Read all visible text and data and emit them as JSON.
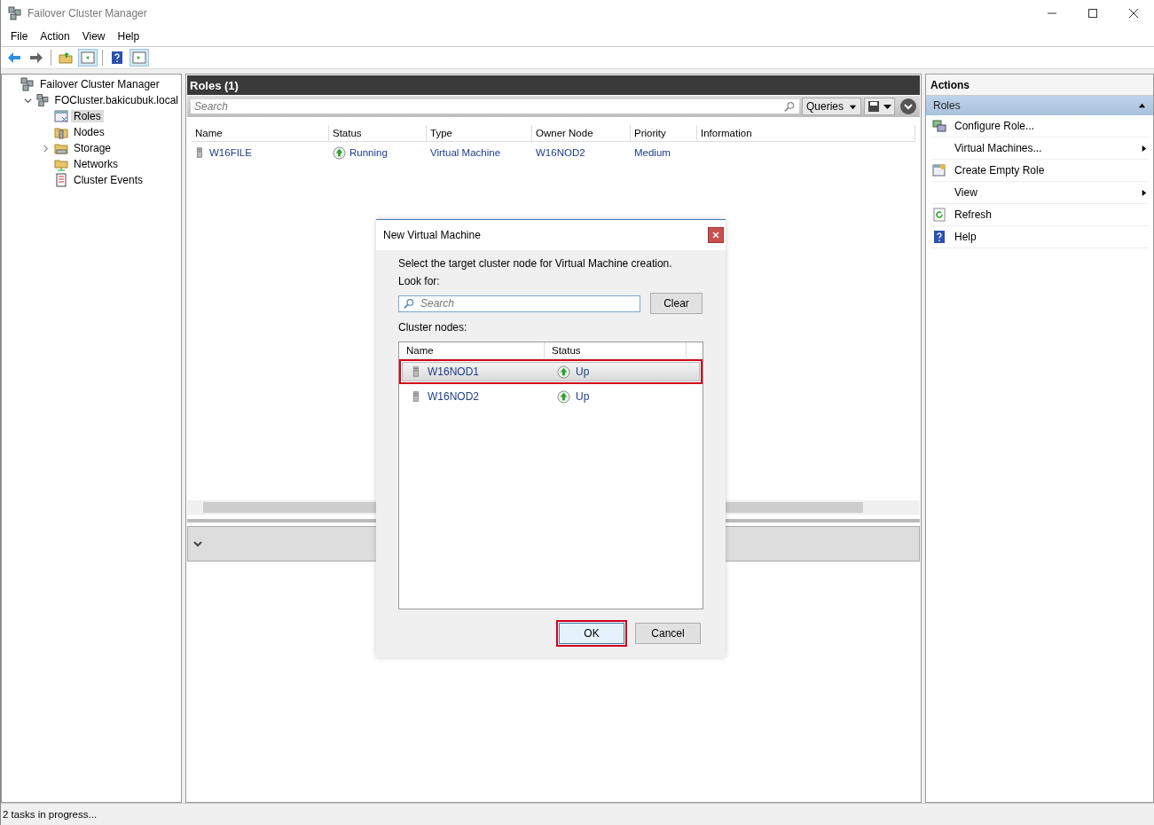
{
  "window": {
    "title": "Failover Cluster Manager"
  },
  "menu": [
    "File",
    "Action",
    "View",
    "Help"
  ],
  "tree": [
    {
      "label": "Failover Cluster Manager",
      "kind": "manager",
      "selected": false,
      "children": [
        {
          "label": "FOCluster.bakicubuk.local",
          "kind": "cluster",
          "selected": false,
          "expanded": true,
          "children": [
            {
              "label": "Roles",
              "kind": "roles",
              "selected": true
            },
            {
              "label": "Nodes",
              "kind": "nodes",
              "selected": false
            },
            {
              "label": "Storage",
              "kind": "storage",
              "selected": false,
              "expanded": false
            },
            {
              "label": "Networks",
              "kind": "networks",
              "selected": false
            },
            {
              "label": "Cluster Events",
              "kind": "events",
              "selected": false
            }
          ]
        }
      ]
    }
  ],
  "roles_panel": {
    "title": "Roles (1)",
    "search_placeholder": "Search",
    "queries": "Queries",
    "columns": [
      "Name",
      "Status",
      "Type",
      "Owner Node",
      "Priority",
      "Information"
    ],
    "rows": [
      {
        "name": "W16FILE",
        "status": "Running",
        "type": "Virtual Machine",
        "owner_node": "W16NOD2",
        "priority": "Medium"
      }
    ]
  },
  "actions": {
    "title": "Actions",
    "section": "Roles",
    "items": [
      {
        "label": "Configure Role...",
        "kind": "configure",
        "submenu": false
      },
      {
        "label": "Virtual Machines...",
        "kind": "plain",
        "submenu": true
      },
      {
        "label": "Create Empty Role",
        "kind": "create",
        "submenu": false
      },
      {
        "label": "View",
        "kind": "plain",
        "submenu": true
      },
      {
        "label": "Refresh",
        "kind": "refresh",
        "submenu": false
      },
      {
        "label": "Help",
        "kind": "help",
        "submenu": false
      }
    ]
  },
  "dialog": {
    "title": "New Virtual Machine",
    "prompt": "Select the target cluster node for Virtual Machine creation.",
    "look_for": "Look for:",
    "search_placeholder": "Search",
    "clear": "Clear",
    "nodes_label": "Cluster nodes:",
    "columns": [
      "Name",
      "Status"
    ],
    "nodes": [
      {
        "name": "W16NOD1",
        "status": "Up",
        "selected": true,
        "highlighted": true
      },
      {
        "name": "W16NOD2",
        "status": "Up",
        "selected": false,
        "highlighted": false
      }
    ],
    "buttons": [
      {
        "label": "OK",
        "default": true,
        "highlighted": true
      },
      {
        "label": "Cancel",
        "default": false,
        "highlighted": false
      }
    ]
  },
  "status_bar": "2 tasks in progress..."
}
